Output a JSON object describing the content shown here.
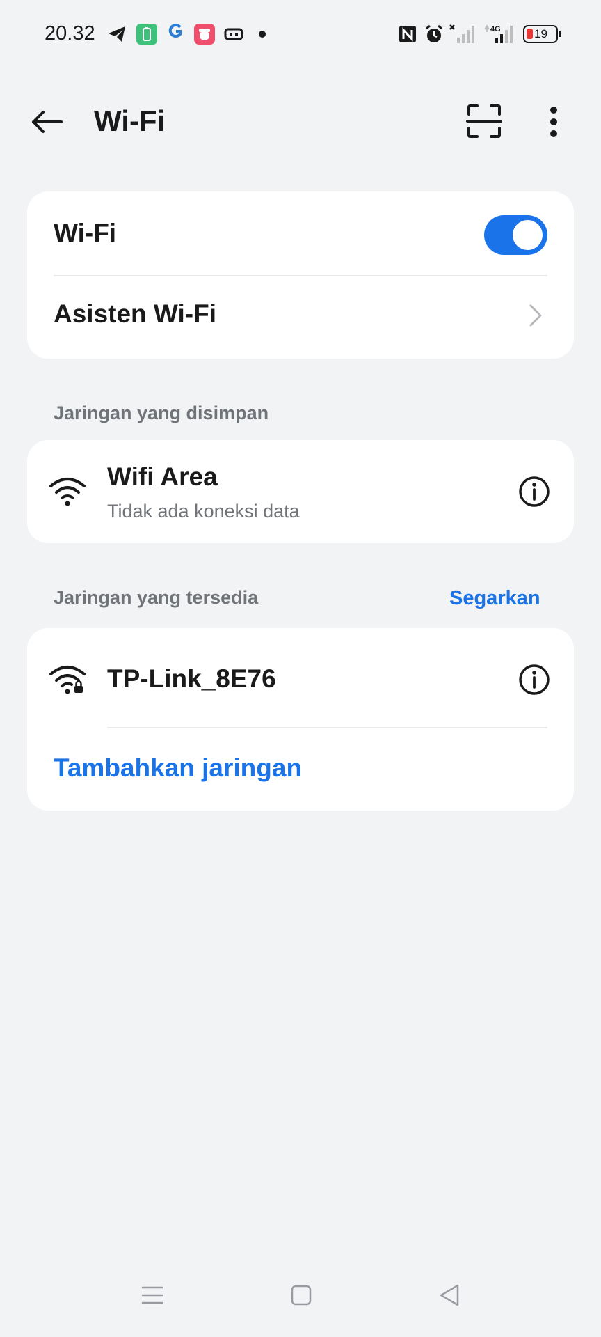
{
  "status_bar": {
    "time": "20.32",
    "battery_level": "19"
  },
  "header": {
    "title": "Wi-Fi",
    "back_icon": "arrow-left-icon",
    "scan_icon": "qr-scan-icon",
    "more_icon": "more-vertical-icon"
  },
  "wifi_card": {
    "wifi_label": "Wi-Fi",
    "wifi_enabled": true,
    "assistant_label": "Asisten Wi-Fi"
  },
  "saved_networks": {
    "section_label": "Jaringan yang disimpan",
    "items": [
      {
        "name": "Wifi Area",
        "status": "Tidak ada koneksi data",
        "secured": false
      }
    ]
  },
  "available_networks": {
    "section_label": "Jaringan yang tersedia",
    "refresh_label": "Segarkan",
    "items": [
      {
        "name": "TP-Link_8E76",
        "secured": true
      }
    ],
    "add_network_label": "Tambahkan jaringan"
  },
  "colors": {
    "accent": "#1a73e8",
    "background": "#f2f3f5",
    "card": "#ffffff",
    "secondary_text": "#707378"
  }
}
